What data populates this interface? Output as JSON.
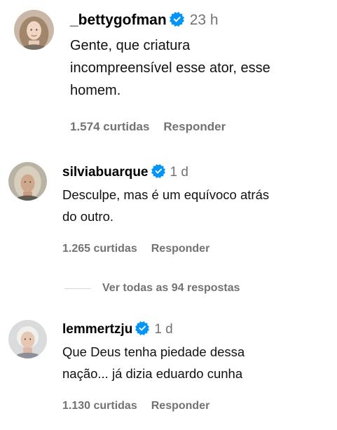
{
  "comments": [
    {
      "username": "_bettygofman",
      "verified": true,
      "time": "23 h",
      "text": "Gente, que criatura\nincompreensível esse ator, esse\nhomem.",
      "likes": "1.574 curtidas",
      "reply": "Responder"
    },
    {
      "username": "silviabuarque",
      "verified": true,
      "time": "1 d",
      "text": "Desculpe, mas é um equívoco atrás\ndo outro.",
      "likes": "1.265 curtidas",
      "reply": "Responder",
      "view_replies": "Ver todas as 94 respostas"
    },
    {
      "username": "lemmertzju",
      "verified": true,
      "time": "1 d",
      "text": "Que Deus tenha piedade dessa\nnação... já dizia eduardo cunha",
      "likes": "1.130 curtidas",
      "reply": "Responder"
    }
  ],
  "colors": {
    "verified_badge": "#0095f6",
    "secondary_text": "#737373",
    "divider": "#d9d9d9"
  },
  "icons": {
    "verified": "verified-badge-icon"
  }
}
